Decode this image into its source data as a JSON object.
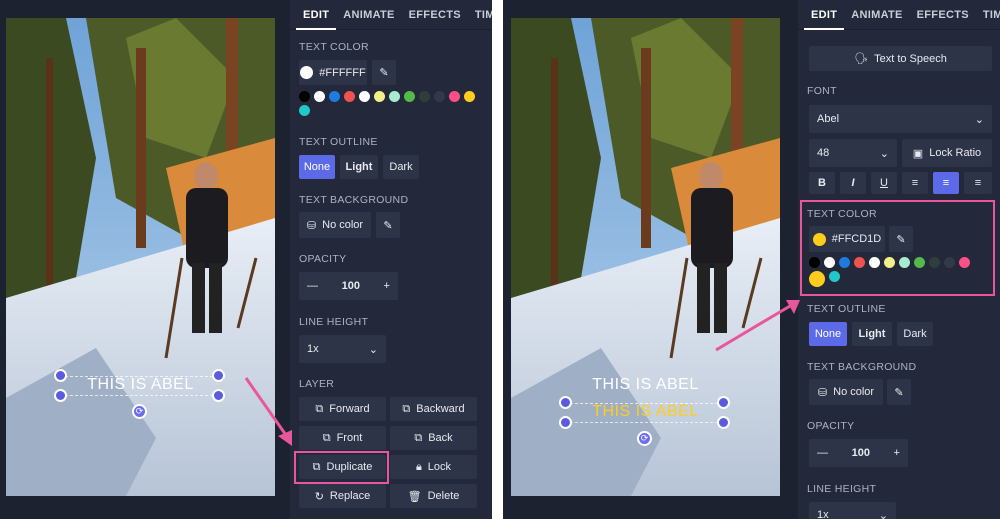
{
  "tabs": [
    "EDIT",
    "ANIMATE",
    "EFFECTS",
    "TIMING"
  ],
  "left": {
    "canvas_text": "THIS IS ABEL",
    "text_color_heading": "TEXT COLOR",
    "color_value": "#FFFFFF",
    "palette": [
      "#000000",
      "#ffffff",
      "#1e7be0",
      "#ef5350",
      "#ffffff",
      "#f3f08a",
      "#a7ecd0",
      "#53b94a",
      "#2e3f3a",
      "#34394a",
      "#ff4f87",
      "#ffcd1d",
      "#20c8c8"
    ],
    "outline_heading": "TEXT OUTLINE",
    "outline_options": [
      "None",
      "Light",
      "Dark"
    ],
    "background_heading": "TEXT BACKGROUND",
    "no_color_label": "No color",
    "opacity_heading": "OPACITY",
    "opacity_value": "100",
    "line_height_heading": "LINE HEIGHT",
    "line_height_value": "1x",
    "layer_heading": "LAYER",
    "layer_buttons": [
      "Forward",
      "Backward",
      "Front",
      "Back",
      "Duplicate",
      "Lock",
      "Replace",
      "Delete"
    ]
  },
  "right": {
    "canvas_text_1": "THIS IS ABEL",
    "canvas_text_2": "THIS IS ABEL",
    "tts_label": "Text to Speech",
    "font_heading": "FONT",
    "font_value": "Abel",
    "size_value": "48",
    "lock_ratio_label": "Lock Ratio",
    "text_color_heading": "TEXT COLOR",
    "color_value": "#FFCD1D",
    "outline_heading": "TEXT OUTLINE",
    "outline_options": [
      "None",
      "Light",
      "Dark"
    ],
    "background_heading": "TEXT BACKGROUND",
    "no_color_label": "No color",
    "opacity_heading": "OPACITY",
    "opacity_value": "100",
    "line_height_heading": "LINE HEIGHT",
    "line_height_value": "1x"
  },
  "colors": {
    "accent": "#5d6ae8",
    "highlight": "#e8569b",
    "panel": "#23283a",
    "yellow_text": "#ffcd1d"
  }
}
